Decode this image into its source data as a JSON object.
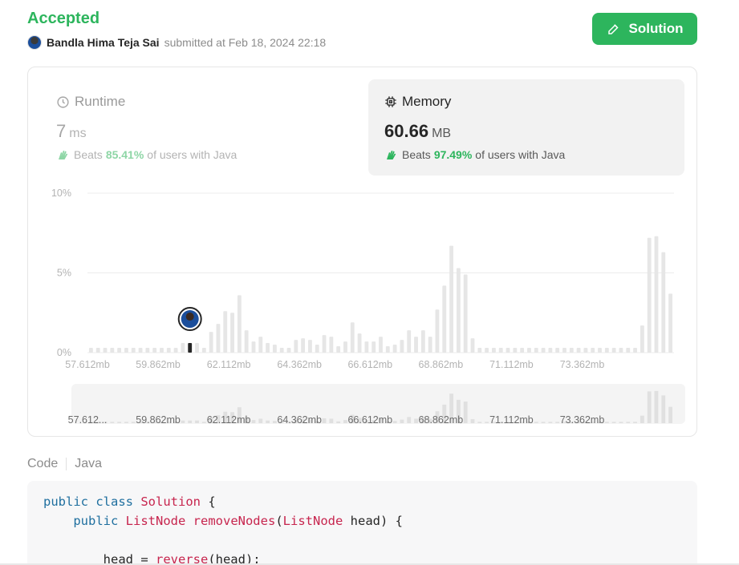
{
  "status": "Accepted",
  "submitter": {
    "name": "Bandla Hima Teja Sai",
    "text": "submitted at Feb 18, 2024 22:18"
  },
  "solution_button": "Solution",
  "runtime": {
    "label": "Runtime",
    "value": "7",
    "unit": "ms",
    "beats_prefix": "Beats",
    "beats_pct": "85.41%",
    "beats_suffix": "of users with Java"
  },
  "memory": {
    "label": "Memory",
    "value": "60.66",
    "unit": "MB",
    "beats_prefix": "Beats",
    "beats_pct": "97.49%",
    "beats_suffix": "of users with Java"
  },
  "chart_data": {
    "type": "bar",
    "ylabel": "",
    "xlabel": "",
    "yticks": [
      "10%",
      "5%",
      "0%"
    ],
    "ylim": [
      0,
      10
    ],
    "xticks": [
      "57.612mb",
      "59.862mb",
      "62.112mb",
      "64.362mb",
      "66.612mb",
      "68.862mb",
      "71.112mb",
      "73.362mb"
    ],
    "overview_xticks": [
      "57.612...",
      "59.862mb",
      "62.112mb",
      "64.362mb",
      "66.612mb",
      "68.862mb",
      "71.112mb",
      "73.362mb"
    ],
    "x_start_mb": 57.612,
    "x_step_mb": 0.225,
    "values": [
      0.3,
      0.3,
      0.3,
      0.3,
      0.3,
      0.3,
      0.3,
      0.3,
      0.3,
      0.3,
      0.3,
      0.3,
      0.3,
      0.6,
      0.6,
      0.6,
      0.3,
      1.3,
      1.8,
      2.6,
      2.5,
      3.6,
      1.4,
      0.7,
      1.0,
      0.6,
      0.5,
      0.3,
      0.3,
      0.8,
      0.9,
      0.8,
      0.5,
      1.1,
      1.0,
      0.4,
      0.7,
      1.9,
      1.2,
      0.7,
      0.7,
      1.0,
      0.4,
      0.5,
      0.8,
      1.4,
      1.0,
      1.4,
      1.0,
      2.7,
      4.2,
      6.7,
      5.3,
      4.9,
      0.9,
      0.3,
      0.3,
      0.3,
      0.3,
      0.3,
      0.3,
      0.3,
      0.3,
      0.3,
      0.3,
      0.3,
      0.3,
      0.3,
      0.3,
      0.3,
      0.3,
      0.3,
      0.3,
      0.3,
      0.3,
      0.3,
      0.3,
      0.3,
      1.7,
      7.2,
      7.3,
      6.3,
      3.7
    ],
    "highlight_index": 14,
    "colors": {
      "bar": "#e6e6e6",
      "highlight": "#262626",
      "grid": "#ececec"
    }
  },
  "code": {
    "tab_label": "Code",
    "language": "Java",
    "lines": [
      [
        [
          "kw",
          "public class "
        ],
        [
          "cls",
          "Solution"
        ],
        [
          "pl",
          " {"
        ]
      ],
      [
        [
          "pl",
          "    "
        ],
        [
          "kw",
          "public "
        ],
        [
          "cls",
          "ListNode "
        ],
        [
          "fn",
          "removeNodes"
        ],
        [
          "pl",
          "("
        ],
        [
          "cls",
          "ListNode "
        ],
        [
          "pl",
          "head) {"
        ]
      ],
      [
        [
          "pl",
          ""
        ]
      ],
      [
        [
          "pl",
          "        head = "
        ],
        [
          "fn",
          "reverse"
        ],
        [
          "pl",
          "(head);"
        ]
      ]
    ]
  }
}
